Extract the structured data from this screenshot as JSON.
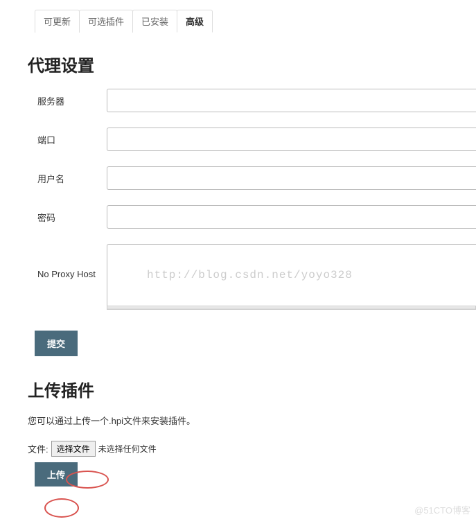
{
  "tabs": {
    "updatable": "可更新",
    "available": "可选插件",
    "installed": "已安装",
    "advanced": "高级"
  },
  "proxy": {
    "title": "代理设置",
    "server_label": "服务器",
    "server_value": "",
    "port_label": "端口",
    "port_value": "",
    "username_label": "用户名",
    "username_value": "",
    "password_label": "密码",
    "password_value": "",
    "noproxy_label": "No Proxy Host",
    "noproxy_value": "",
    "submit_label": "提交"
  },
  "upload": {
    "title": "上传插件",
    "desc": "您可以通过上传一个.hpi文件来安装插件。",
    "file_label": "文件:",
    "choose_button": "选择文件",
    "no_file": "未选择任何文件",
    "upload_button": "上传"
  },
  "watermark": {
    "url": "http://blog.csdn.net/yoyo328",
    "site": "@51CTO博客"
  }
}
